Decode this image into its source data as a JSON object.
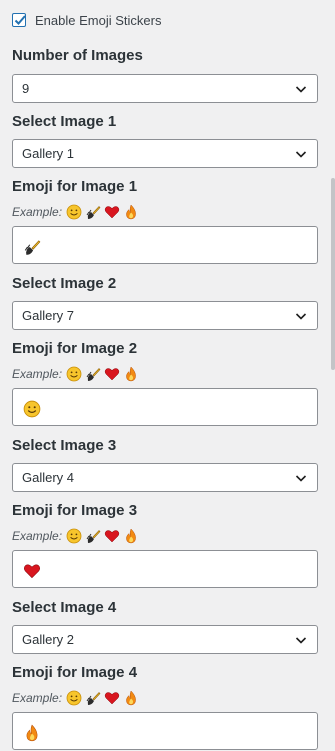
{
  "enable_emoji": {
    "label": "Enable Emoji Stickers",
    "checked": true
  },
  "number_of_images": {
    "label": "Number of Images",
    "value": "9"
  },
  "example_label": "Example:",
  "example_icons": [
    "smiley-emoji-icon",
    "brush-emoji-icon",
    "heart-emoji-icon",
    "fire-emoji-icon"
  ],
  "images": [
    {
      "select_label": "Select Image 1",
      "gallery": "Gallery 1",
      "emoji_label": "Emoji for Image 1",
      "emoji_value_icon": "brush-emoji-icon"
    },
    {
      "select_label": "Select Image 2",
      "gallery": "Gallery 7",
      "emoji_label": "Emoji for Image 2",
      "emoji_value_icon": "smiley-emoji-icon"
    },
    {
      "select_label": "Select Image 3",
      "gallery": "Gallery 4",
      "emoji_label": "Emoji for Image 3",
      "emoji_value_icon": "heart-emoji-icon"
    },
    {
      "select_label": "Select Image 4",
      "gallery": "Gallery 2",
      "emoji_label": "Emoji for Image 4",
      "emoji_value_icon": "fire-emoji-icon"
    }
  ],
  "colors": {
    "accent": "#2271b1",
    "border": "#8c8f94",
    "background": "#f0f0f1"
  }
}
